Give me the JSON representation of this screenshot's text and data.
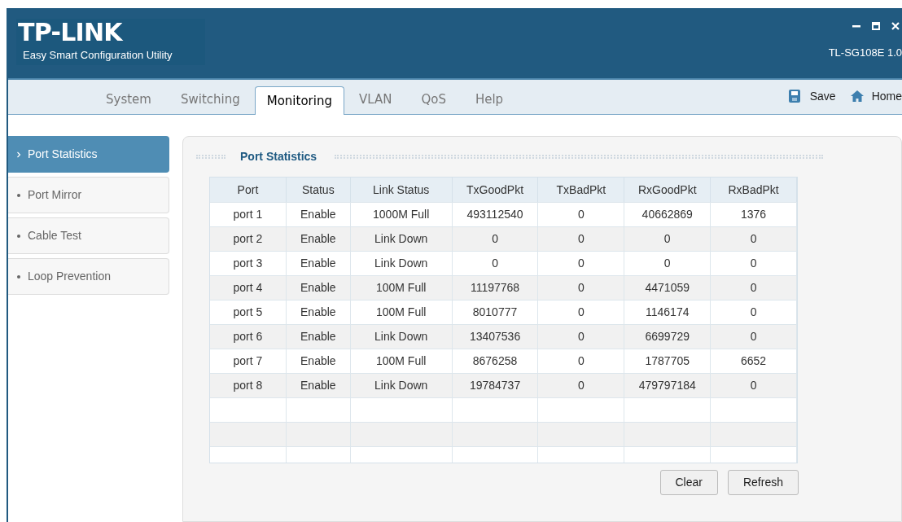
{
  "header": {
    "logo": "TP-LINK",
    "subtitle": "Easy Smart Configuration Utility",
    "model": "TL-SG108E 1.0"
  },
  "window_controls": [
    {
      "kind": "minimize"
    },
    {
      "kind": "maximize"
    },
    {
      "kind": "close"
    }
  ],
  "tabs": [
    {
      "label": "System",
      "selected": false
    },
    {
      "label": "Switching",
      "selected": false
    },
    {
      "label": "Monitoring",
      "selected": true
    },
    {
      "label": "VLAN",
      "selected": false
    },
    {
      "label": "QoS",
      "selected": false
    },
    {
      "label": "Help",
      "selected": false
    }
  ],
  "actions": [
    {
      "kind": "save",
      "label": "Save"
    },
    {
      "kind": "home",
      "label": "Home"
    }
  ],
  "sidebar": {
    "items": [
      {
        "label": "Port Statistics",
        "selected": true
      },
      {
        "label": "Port Mirror",
        "selected": false
      },
      {
        "label": "Cable Test",
        "selected": false
      },
      {
        "label": "Loop Prevention",
        "selected": false
      }
    ]
  },
  "panel": {
    "title": "Port Statistics",
    "table": {
      "columns": [
        "Port",
        "Status",
        "Link Status",
        "TxGoodPkt",
        "TxBadPkt",
        "RxGoodPkt",
        "RxBadPkt"
      ],
      "rows": [
        [
          "port 1",
          "Enable",
          "1000M Full",
          "493112540",
          "0",
          "40662869",
          "1376"
        ],
        [
          "port 2",
          "Enable",
          "Link Down",
          "0",
          "0",
          "0",
          "0"
        ],
        [
          "port 3",
          "Enable",
          "Link Down",
          "0",
          "0",
          "0",
          "0"
        ],
        [
          "port 4",
          "Enable",
          "100M Full",
          "11197768",
          "0",
          "4471059",
          "0"
        ],
        [
          "port 5",
          "Enable",
          "100M Full",
          "8010777",
          "0",
          "1146174",
          "0"
        ],
        [
          "port 6",
          "Enable",
          "Link Down",
          "13407536",
          "0",
          "6699729",
          "0"
        ],
        [
          "port 7",
          "Enable",
          "100M Full",
          "8676258",
          "0",
          "1787705",
          "6652"
        ],
        [
          "port 8",
          "Enable",
          "Link Down",
          "19784737",
          "0",
          "479797184",
          "0"
        ]
      ]
    },
    "buttons": [
      "Clear",
      "Refresh"
    ]
  }
}
